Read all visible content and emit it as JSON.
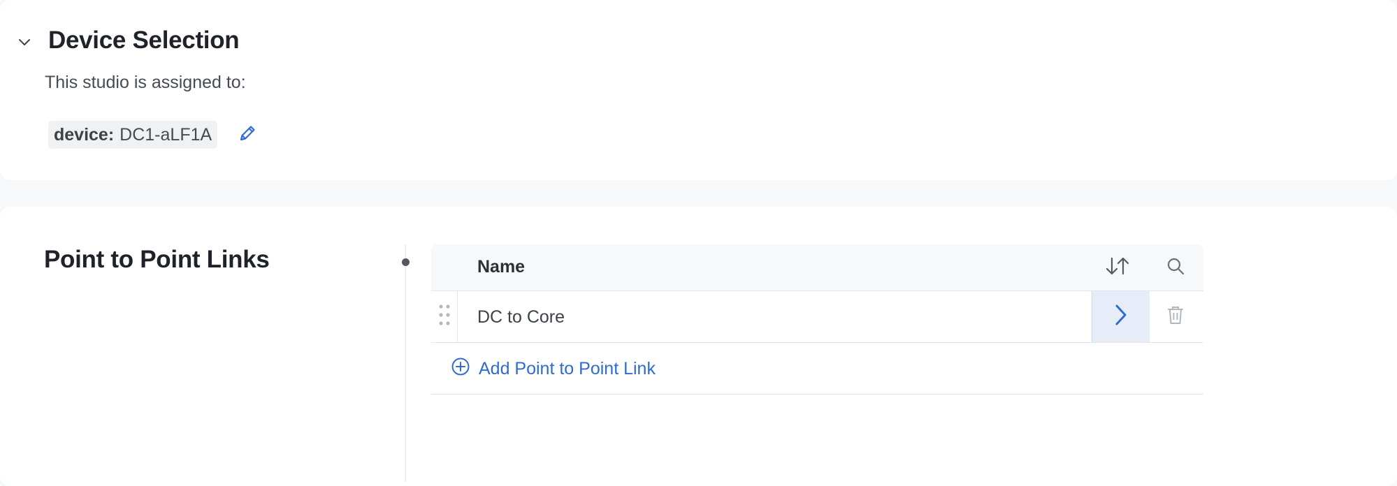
{
  "device_selection": {
    "title": "Device Selection",
    "assigned_text": "This studio is assigned to:",
    "tag_key": "device:",
    "tag_value": "DC1-aLF1A",
    "icons": {
      "collapse": "chevron-down-icon",
      "edit": "pencil-icon"
    }
  },
  "p2p": {
    "title": "Point to Point Links",
    "table": {
      "column_name": "Name",
      "rows": [
        {
          "name": "DC to Core"
        }
      ],
      "add_label": "Add Point to Point Link",
      "icons": {
        "sort": "sort-icon",
        "search": "search-icon",
        "drag": "drag-handle-icon",
        "open": "chevron-right-icon",
        "delete": "trash-icon",
        "add": "plus-circle-icon"
      }
    }
  },
  "colors": {
    "accent": "#2f6bd0",
    "selected_bg": "#e6edf8",
    "page_bg": "#f7f8fa"
  }
}
